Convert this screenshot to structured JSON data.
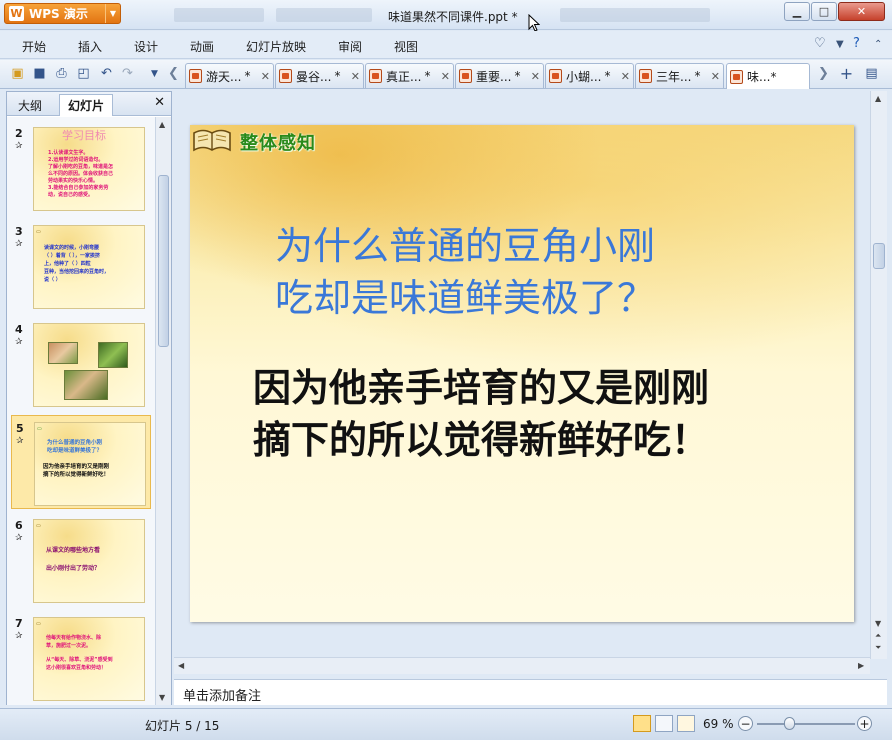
{
  "app": {
    "logo": "WPS 演示",
    "window_title": "味道果然不同课件.ppt *"
  },
  "menu": [
    "开始",
    "插入",
    "设计",
    "动画",
    "幻灯片放映",
    "审阅",
    "视图"
  ],
  "tabs": [
    {
      "label": "游天...",
      "modified": "*"
    },
    {
      "label": "曼谷...",
      "modified": "*"
    },
    {
      "label": "真正...",
      "modified": "*"
    },
    {
      "label": "重要...",
      "modified": "*"
    },
    {
      "label": "小蝴...",
      "modified": "*"
    },
    {
      "label": "三年...",
      "modified": "*"
    },
    {
      "label": "味...*",
      "modified": ""
    }
  ],
  "left_panel": {
    "tab_outline": "大纲",
    "tab_slides": "幻灯片"
  },
  "thumbnails": [
    {
      "num": "2",
      "title": "学习目标",
      "lines": [
        "1.认读课文生字。",
        "2.运用学过的词语造句。",
        "了解小刚吃的豆角，味道是怎",
        "么不同的原因。体会收获自己",
        "劳动果实的快乐心情。",
        "3.能结合自己参加的家务劳",
        "动，说自己的感受。"
      ],
      "color": "#e0157a"
    },
    {
      "num": "3",
      "title": "",
      "lines": [
        "读课文的时候，小刚弯腰",
        "（  ）着背（  ），一家挨挤",
        "上，他种了（  ）四粒",
        "豆种，当他挖回来的豆角时，",
        "说（  ）"
      ],
      "color": "#2233cc"
    },
    {
      "num": "4",
      "title": "",
      "lines": [],
      "color": "#333"
    },
    {
      "num": "5",
      "title": "",
      "lines": [
        "为什么普通的豆角小刚",
        "吃却是味道鲜美极了？",
        "因为他亲手培育的又是刚刚",
        "摘下的所以觉得新鲜好吃！"
      ],
      "color": "#3a78d8"
    },
    {
      "num": "6",
      "title": "",
      "lines": [
        "从课文的哪些地方看",
        "出小刚付出了劳动？"
      ],
      "color": "#8a1070"
    },
    {
      "num": "7",
      "title": "",
      "lines": [
        "他每天有给作物浇水、除",
        "草，施肥过一次泥。",
        "从“每天、除草、浇泥”感受到",
        "这小刚很喜欢豆角和劳动！"
      ],
      "color": "#e0157a"
    }
  ],
  "slide": {
    "header": "整体感知",
    "question": [
      "为什么普通的豆角小刚",
      "吃却是味道鲜美极了？"
    ],
    "answer": [
      "因为他亲手培育的又是刚刚",
      "摘下的所以觉得新鲜好吃！"
    ]
  },
  "notes_placeholder": "单击添加备注",
  "status": {
    "slide_counter": "幻灯片 5 / 15",
    "zoom": "69 %"
  }
}
